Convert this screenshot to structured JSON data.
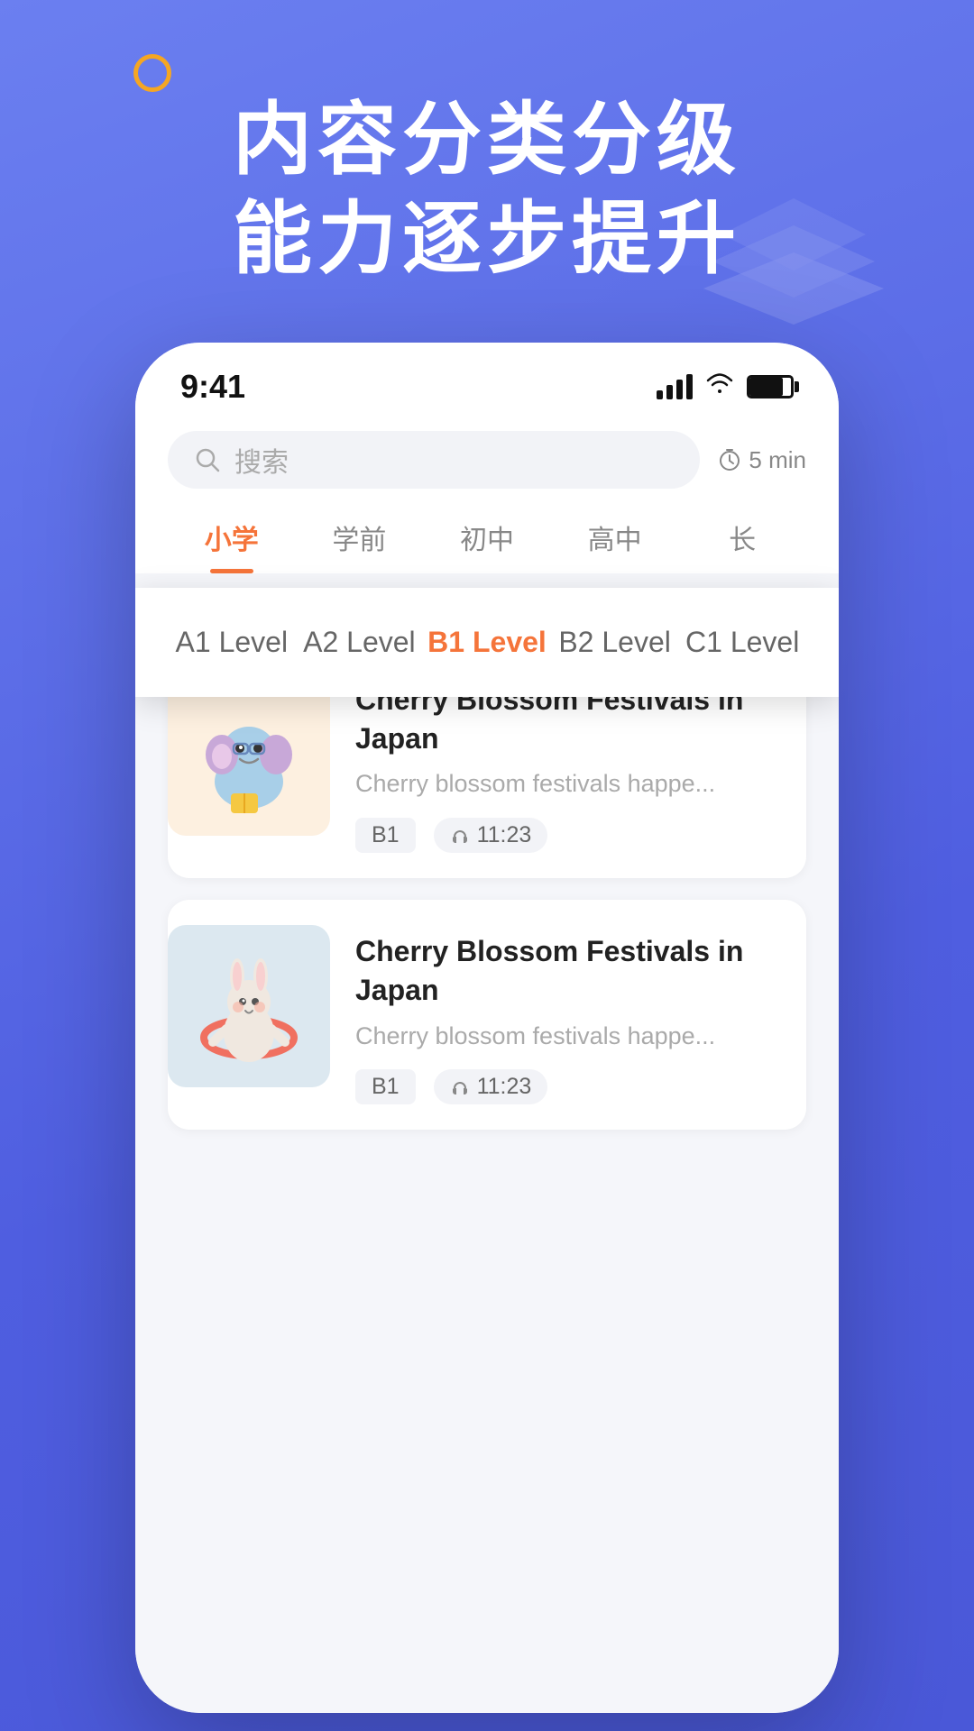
{
  "page": {
    "background_gradient_start": "#6b7ff0",
    "background_gradient_end": "#4a58d8"
  },
  "orange_dot": {
    "visible": true
  },
  "hero": {
    "line1": "内容分类分级",
    "line2": "能力逐步提升"
  },
  "phone": {
    "status_bar": {
      "time": "9:41"
    },
    "search": {
      "placeholder": "搜索",
      "timer_label": "5 min"
    },
    "category_tabs": [
      {
        "id": "preschool",
        "label": "学前",
        "active": false
      },
      {
        "id": "primary",
        "label": "小学",
        "active": true
      },
      {
        "id": "middle",
        "label": "初中",
        "active": false
      },
      {
        "id": "high",
        "label": "高中",
        "active": false
      },
      {
        "id": "more",
        "label": "长",
        "active": false
      }
    ],
    "floating_level_tabs": [
      {
        "id": "a1",
        "label": "A1 Level",
        "active": false
      },
      {
        "id": "a2",
        "label": "A2 Level",
        "active": false
      },
      {
        "id": "b1",
        "label": "B1 Level",
        "active": true
      },
      {
        "id": "b2",
        "label": "B2 Level",
        "active": false
      },
      {
        "id": "c1",
        "label": "C1 Level",
        "active": false
      }
    ],
    "sub_level_tabs": [
      {
        "id": "a1",
        "label": "A1 level",
        "active": false
      },
      {
        "id": "a2",
        "label": "A2 Level",
        "active": false
      },
      {
        "id": "b1",
        "label": "B1 Level",
        "active": true
      },
      {
        "id": "b2",
        "label": "B2 Level",
        "active": false
      },
      {
        "id": "c1",
        "label": "C1 Level",
        "active": false
      }
    ],
    "cards": [
      {
        "id": "card1",
        "title": "Cherry Blossom Festivals in Japan",
        "description": "Cherry blossom festivals happe...",
        "level": "B1",
        "duration": "11:23",
        "thumb_style": "warm",
        "character": "elephant"
      },
      {
        "id": "card2",
        "title": "Cherry Blossom Festivals in Japan",
        "description": "Cherry blossom festivals happe...",
        "level": "B1",
        "duration": "11:23",
        "thumb_style": "cool",
        "character": "bunny"
      }
    ]
  }
}
